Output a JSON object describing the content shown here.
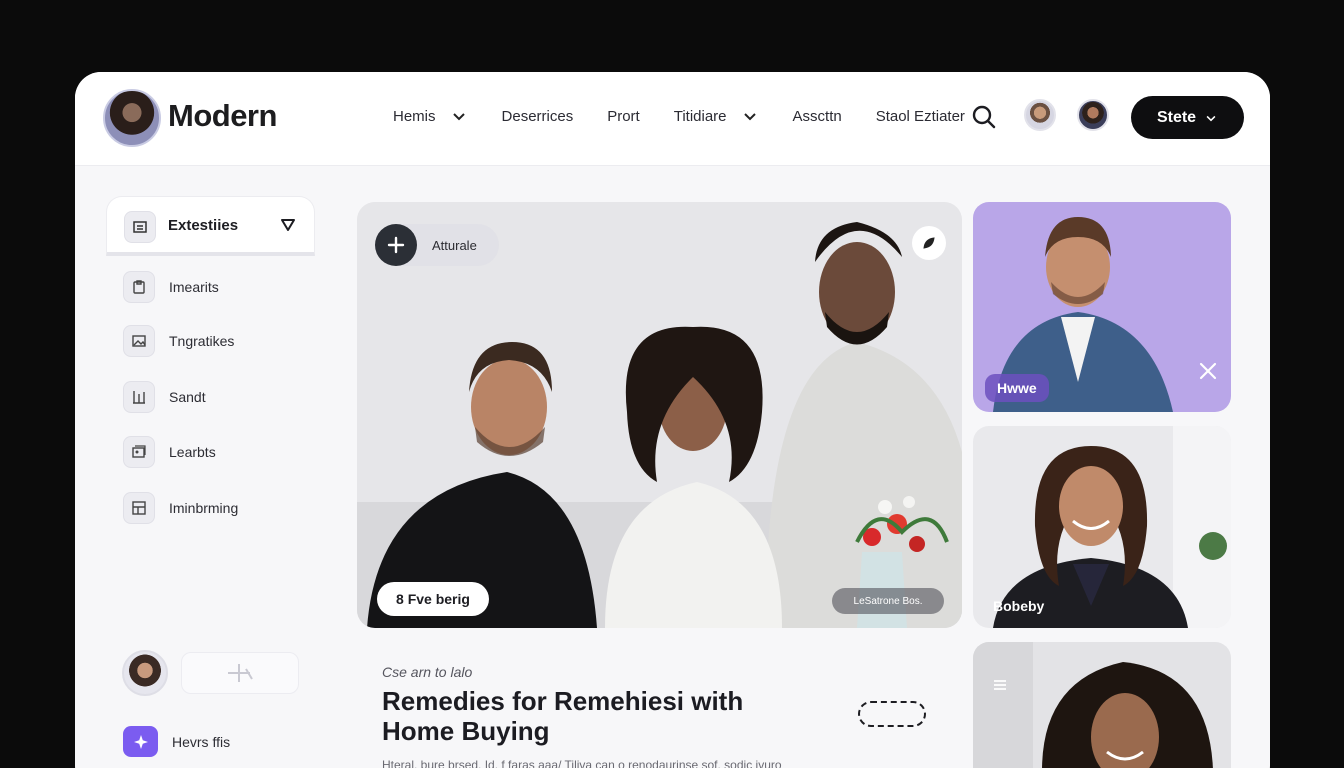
{
  "brand": {
    "name": "Modern"
  },
  "nav": {
    "items": [
      {
        "label": "Hemis",
        "has_dropdown": true
      },
      {
        "label": "Deserrices",
        "has_dropdown": false
      },
      {
        "label": "Prort",
        "has_dropdown": false
      },
      {
        "label": "Titidiare",
        "has_dropdown": true
      },
      {
        "label": "Asscttn",
        "has_dropdown": false
      },
      {
        "label": "Staol Eztiater",
        "has_dropdown": false
      }
    ],
    "cta_label": "Stete"
  },
  "sidebar": {
    "header_label": "Extestiies",
    "items": [
      {
        "label": "Imearits",
        "icon": "clipboard-icon"
      },
      {
        "label": "Tngratikes",
        "icon": "image-icon"
      },
      {
        "label": "Sandt",
        "icon": "columns-icon"
      },
      {
        "label": "Learbts",
        "icon": "gallery-icon"
      },
      {
        "label": "Iminbrming",
        "icon": "layout-icon"
      }
    ],
    "footer_label": "Hevrs ffis"
  },
  "hero": {
    "chip_label": "Atturale",
    "pill_label": "8 Fve berig",
    "tag_label": "LeSatrone Bos."
  },
  "article": {
    "eyebrow": "Cse arn to lalo",
    "title": "Remedies for Remehiesi with Home Buying",
    "excerpt": "Hteral, bure brsed. Id. f faras aaa/ Tiliva can o renodaurinse sof. sodic ivuro"
  },
  "cards": [
    {
      "label": "Hwwe",
      "bg": "#b9a6e8"
    },
    {
      "label": "Bobeby",
      "bg": "#e9e9ec"
    },
    {
      "label": "",
      "bg": "#e3e3e6"
    }
  ],
  "colors": {
    "accent": "#7b5cf0",
    "cta_bg": "#0e0e10",
    "page_bg": "#0b0b0b",
    "panel_bg": "#f7f7f9"
  }
}
